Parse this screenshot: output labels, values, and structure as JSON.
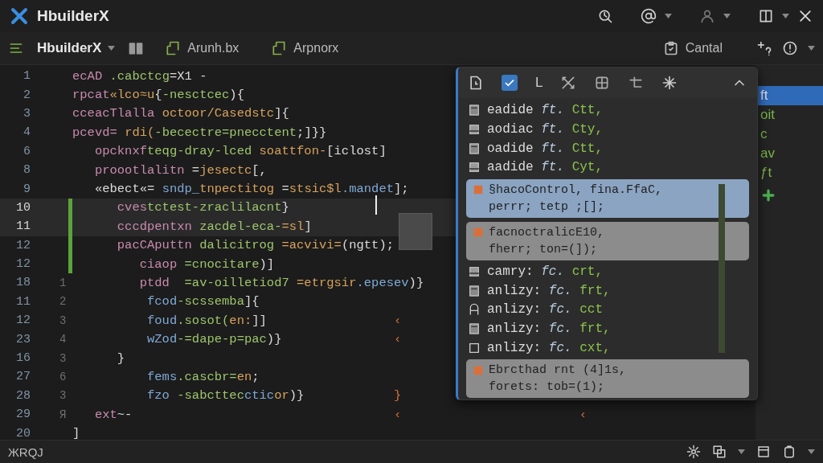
{
  "titlebar": {
    "app": "HbuilderX"
  },
  "toolbar": {
    "project": "HbuilderX",
    "tabs": [
      {
        "label": "Arunh.bx",
        "selected": false
      },
      {
        "label": "Arpnorx",
        "selected": false
      }
    ],
    "action": "Cantal"
  },
  "editor": {
    "lines": [
      {
        "number": "1",
        "current": false,
        "changed": false,
        "tokens": [
          {
            "kind": "key",
            "text": "ecAD "
          },
          {
            "kind": "name",
            "text": ".cabctcg"
          },
          {
            "kind": "punct",
            "text": "=X1 -"
          }
        ]
      },
      {
        "number": "2",
        "current": false,
        "changed": false,
        "tokens": [
          {
            "kind": "key",
            "text": "rpcat"
          },
          {
            "kind": "str",
            "text": "«lco≈u"
          },
          {
            "kind": "punct",
            "text": "{"
          },
          {
            "kind": "name",
            "text": "-nesctcec"
          },
          {
            "kind": "punct",
            "text": "){"
          }
        ]
      },
      {
        "number": "3",
        "current": false,
        "changed": false,
        "tokens": [
          {
            "kind": "key",
            "text": "cceacTlalla "
          },
          {
            "kind": "str",
            "text": "octoor/Casedstc"
          },
          {
            "kind": "punct",
            "text": "]{"
          }
        ]
      },
      {
        "number": "4",
        "current": false,
        "changed": false,
        "tokens": [
          {
            "kind": "key",
            "text": "pcevd= "
          },
          {
            "kind": "str",
            "text": "rdi("
          },
          {
            "kind": "name",
            "text": "-becectre=pnecctent"
          },
          {
            "kind": "punct",
            "text": ";]}}"
          }
        ]
      },
      {
        "number": "6",
        "current": false,
        "changed": false,
        "tokens": [
          {
            "kind": "key",
            "text": "   opcknxf"
          },
          {
            "kind": "name",
            "text": "teqg-dray-lced "
          },
          {
            "kind": "str",
            "text": "soattfon-"
          },
          {
            "kind": "punct",
            "text": "[iclost]"
          }
        ]
      },
      {
        "number": "8",
        "current": false,
        "changed": false,
        "tokens": [
          {
            "kind": "key",
            "text": "   proootlalitn "
          },
          {
            "kind": "punct",
            "text": "="
          },
          {
            "kind": "str",
            "text": "jesectc"
          },
          {
            "kind": "punct",
            "text": "[,"
          }
        ]
      },
      {
        "number": "9",
        "current": false,
        "changed": false,
        "tokens": [
          {
            "kind": "punct",
            "text": "   «ebect«= "
          },
          {
            "kind": "type",
            "text": "sndp_"
          },
          {
            "kind": "str",
            "text": "tnpectitog "
          },
          {
            "kind": "punct",
            "text": "="
          },
          {
            "kind": "str",
            "text": "stsic$l"
          },
          {
            "kind": "type",
            "text": ".mandet"
          },
          {
            "kind": "punct",
            "text": "];"
          }
        ]
      },
      {
        "number": "10",
        "current": true,
        "changed": true,
        "tokens": [
          {
            "kind": "key",
            "text": "      cves"
          },
          {
            "kind": "name",
            "text": "tctest-zraclilacnt"
          },
          {
            "kind": "punct",
            "text": "}"
          }
        ]
      },
      {
        "number": "11",
        "current": true,
        "changed": true,
        "tokens": [
          {
            "kind": "key",
            "text": "      cccdpentxn "
          },
          {
            "kind": "name",
            "text": "zacdel-eca-"
          },
          {
            "kind": "str",
            "text": "=sl"
          },
          {
            "kind": "punct",
            "text": "]"
          }
        ]
      },
      {
        "number": "12",
        "current": false,
        "changed": true,
        "tokens": [
          {
            "kind": "key",
            "text": "      pacCAputtn "
          },
          {
            "kind": "name",
            "text": "dalicitrog "
          },
          {
            "kind": "str",
            "text": "=acvivi="
          },
          {
            "kind": "punct",
            "text": "(ngtt);"
          }
        ]
      },
      {
        "number": "12",
        "current": false,
        "changed": true,
        "tokens": [
          {
            "kind": "key",
            "text": "         ciaop "
          },
          {
            "kind": "name",
            "text": "=cnocitare"
          },
          {
            "kind": "punct",
            "text": ")]"
          }
        ]
      },
      {
        "number": "18",
        "gutter": "1",
        "current": false,
        "changed": false,
        "tokens": [
          {
            "kind": "key",
            "text": "         ptdd  "
          },
          {
            "kind": "name",
            "text": "=av-oilletiod7 "
          },
          {
            "kind": "str",
            "text": "=etrgsir"
          },
          {
            "kind": "type",
            "text": ".epesev"
          },
          {
            "kind": "punct",
            "text": ")}"
          }
        ]
      },
      {
        "number": "11",
        "gutter": "2",
        "current": false,
        "changed": false,
        "tokens": [
          {
            "kind": "type",
            "text": "          fcod"
          },
          {
            "kind": "name",
            "text": "-scssemba"
          },
          {
            "kind": "punct",
            "text": "]{"
          }
        ]
      },
      {
        "number": "12",
        "gutter": "3",
        "current": false,
        "changed": false,
        "tokens": [
          {
            "kind": "type",
            "text": "          foud"
          },
          {
            "kind": "name",
            "text": ".sosot("
          },
          {
            "kind": "str",
            "text": "en:"
          },
          {
            "kind": "punct",
            "text": "]]"
          }
        ],
        "trail": [
          "‹"
        ]
      },
      {
        "number": "23",
        "gutter": "4",
        "current": false,
        "changed": false,
        "tokens": [
          {
            "kind": "type",
            "text": "          wZod"
          },
          {
            "kind": "name",
            "text": "-=dape-p=pac"
          },
          {
            "kind": "punct",
            "text": ")}"
          }
        ],
        "trail": [
          "‹"
        ]
      },
      {
        "number": "16",
        "gutter": "3",
        "current": false,
        "changed": false,
        "tokens": [
          {
            "kind": "punct",
            "text": "      }"
          }
        ]
      },
      {
        "number": "27",
        "gutter": "6",
        "current": false,
        "changed": false,
        "tokens": [
          {
            "kind": "type",
            "text": "          fems"
          },
          {
            "kind": "name",
            "text": ".cascbr="
          },
          {
            "kind": "str",
            "text": "en"
          },
          {
            "kind": "punct",
            "text": ";"
          }
        ]
      },
      {
        "number": "28",
        "gutter": "3",
        "current": false,
        "changed": false,
        "tokens": [
          {
            "kind": "type",
            "text": "          fzo "
          },
          {
            "kind": "name",
            "text": "-sabcttec"
          },
          {
            "kind": "type",
            "text": "ctic"
          },
          {
            "kind": "str",
            "text": "or"
          },
          {
            "kind": "punct",
            "text": ")}"
          }
        ],
        "trail": [
          "}"
        ]
      },
      {
        "number": "29",
        "gutter": "Я",
        "current": false,
        "changed": false,
        "tokens": [
          {
            "kind": "key",
            "text": "   ext"
          },
          {
            "kind": "punct",
            "text": "~-"
          }
        ],
        "trail": [
          "‹",
          "‹"
        ]
      },
      {
        "number": "20",
        "current": false,
        "changed": false,
        "tokens": [
          {
            "kind": "punct",
            "text": "]"
          }
        ]
      }
    ]
  },
  "popup": {
    "header": {
      "label": "L"
    },
    "items": [
      {
        "kind": "row",
        "text": "eadide",
        "mid": "ft.",
        "end": "Ctt,"
      },
      {
        "kind": "row",
        "text": "aodiac",
        "mid": "ft.",
        "end": "Cty,"
      },
      {
        "kind": "row",
        "text": "oadide",
        "mid": "ft.",
        "end": "Ctt,"
      },
      {
        "kind": "row",
        "text": "aadide",
        "mid": "ft.",
        "end": "Cyt,"
      },
      {
        "kind": "card",
        "selected": true,
        "lines": [
          "§hacoControl, fina.FfaC,",
          "perrr; tetp ;[];"
        ]
      },
      {
        "kind": "card",
        "selected": false,
        "lines": [
          "facnoctralicE10,",
          "fherr; ton=(]);"
        ]
      },
      {
        "kind": "row",
        "text": "camry:",
        "mid": "fc.",
        "end": "crt,"
      },
      {
        "kind": "row",
        "text": "anlizy:",
        "mid": "fc.",
        "end": "frt,"
      },
      {
        "kind": "row",
        "text": "anlizy:",
        "mid": "fc.",
        "end": "cct"
      },
      {
        "kind": "row",
        "text": "anlizy:",
        "mid": "fc.",
        "end": "frt,"
      },
      {
        "kind": "row",
        "text": "anlizy:",
        "mid": "fc.",
        "end": "cxt,"
      },
      {
        "kind": "card",
        "selected": false,
        "lines": [
          "Ebrcthad rnt (4]1s,",
          "forets: tob=(1);"
        ]
      }
    ]
  },
  "sidebar": {
    "items": [
      {
        "label": "ft",
        "selected": true
      },
      {
        "label": "oit",
        "selected": false
      },
      {
        "label": "c",
        "selected": false
      },
      {
        "label": "av",
        "selected": false
      },
      {
        "label": "ƒt",
        "selected": false
      }
    ]
  },
  "status_bar": {
    "text": "ЖRQJ"
  }
}
